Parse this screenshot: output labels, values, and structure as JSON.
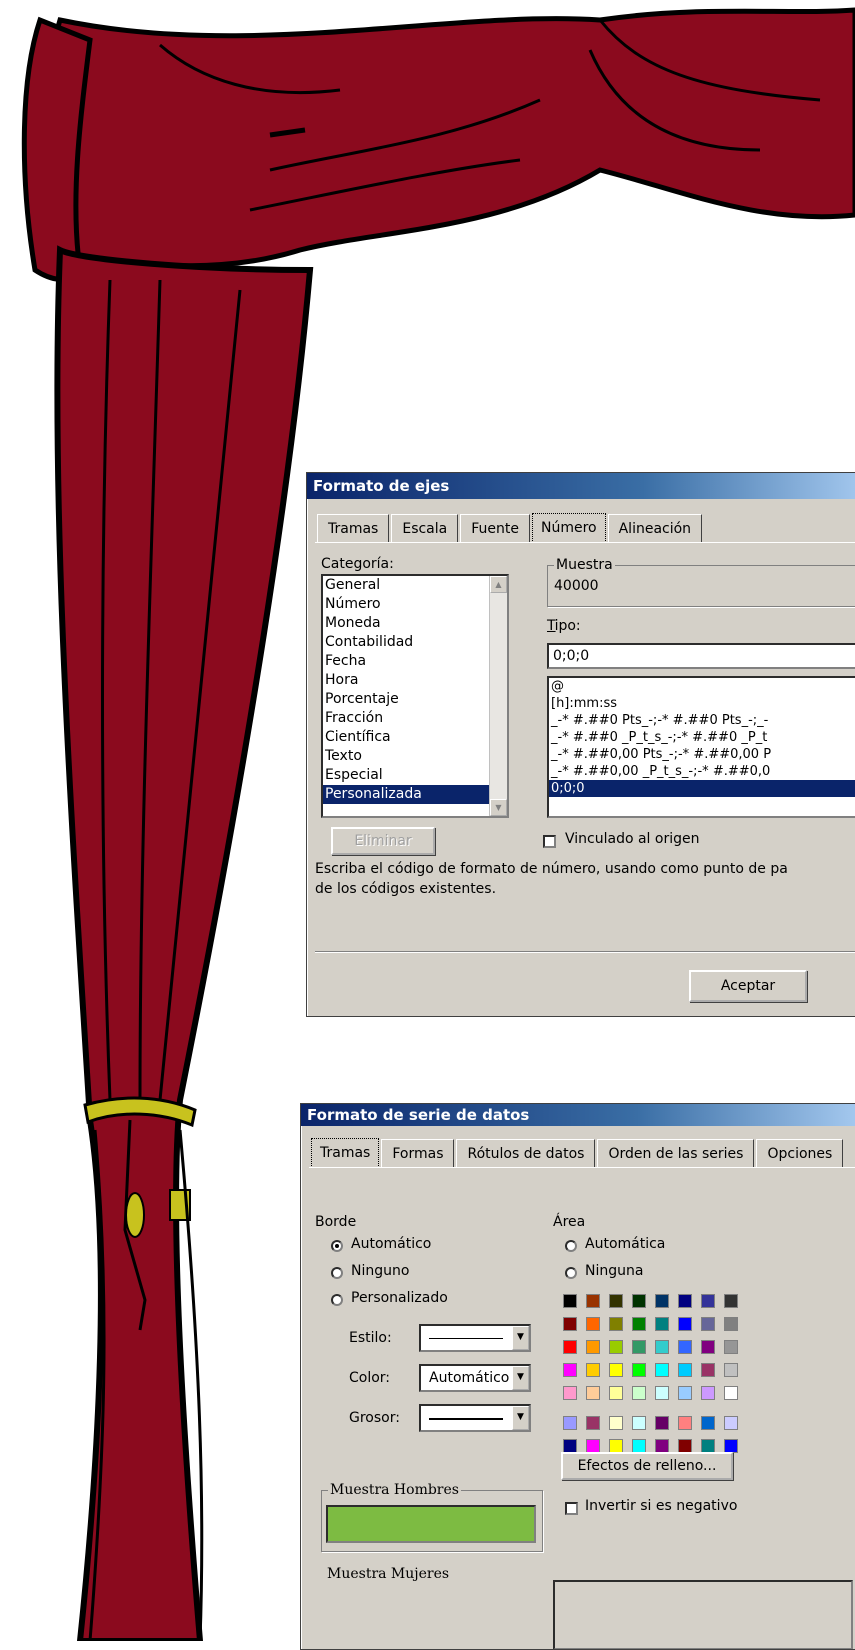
{
  "dialog1": {
    "title": "Formato de ejes",
    "tabs": [
      "Tramas",
      "Escala",
      "Fuente",
      "Número",
      "Alineación"
    ],
    "category_label": "Categoría:",
    "categories": [
      "General",
      "Número",
      "Moneda",
      "Contabilidad",
      "Fecha",
      "Hora",
      "Porcentaje",
      "Fracción",
      "Científica",
      "Texto",
      "Especial",
      "Personalizada"
    ],
    "selected_category": "Personalizada",
    "sample_label": "Muestra",
    "sample_value": "40000",
    "type_label": "Tipo:",
    "type_value": "0;0;0",
    "formats": [
      "@",
      "[h]:mm:ss",
      "_-* #.##0 Pts_-;-* #.##0 Pts_-;_-",
      "_-* #.##0 _P_t_s_-;-* #.##0 _P_t",
      "_-* #.##0,00 Pts_-;-* #.##0,00 P",
      "_-* #.##0,00 _P_t_s_-;-* #.##0,0",
      "0;0;0"
    ],
    "delete_button": "Eliminar",
    "linked_label": "Vinculado al origen",
    "description_line1": "Escriba el código de formato de número, usando como punto de pa",
    "description_line2": "de los códigos existentes.",
    "ok_button": "Aceptar"
  },
  "dialog2": {
    "title": "Formato de serie de datos",
    "tabs": [
      "Tramas",
      "Formas",
      "Rótulos de datos",
      "Orden de las series",
      "Opciones"
    ],
    "border_group": "Borde",
    "border_options": [
      "Automático",
      "Ninguno",
      "Personalizado"
    ],
    "border_selected": "Automático",
    "style_label": "Estilo:",
    "color_label": "Color:",
    "color_value": "Automático",
    "weight_label": "Grosor:",
    "sample_men_label": "Muestra Hombres",
    "sample_men_color": "#7dbb42",
    "sample_women_label": "Muestra Mujeres",
    "area_group": "Área",
    "area_options": [
      "Automática",
      "Ninguna"
    ],
    "fill_effects_button": "Efectos de relleno...",
    "invert_label": "Invertir si es negativo",
    "palette_rows": [
      [
        "#000000",
        "#993300",
        "#333300",
        "#003300",
        "#003366",
        "#000080",
        "#333399",
        "#333333"
      ],
      [
        "#800000",
        "#ff6600",
        "#808000",
        "#008000",
        "#008080",
        "#0000ff",
        "#666699",
        "#808080"
      ],
      [
        "#ff0000",
        "#ff9900",
        "#99cc00",
        "#339966",
        "#33cccc",
        "#3366ff",
        "#800080",
        "#969696"
      ],
      [
        "#ff00ff",
        "#ffcc00",
        "#ffff00",
        "#00ff00",
        "#00ffff",
        "#00ccff",
        "#993366",
        "#c0c0c0"
      ],
      [
        "#ff99cc",
        "#ffcc99",
        "#ffff99",
        "#ccffcc",
        "#ccffff",
        "#99ccff",
        "#cc99ff",
        "#ffffff"
      ]
    ],
    "palette_extra_rows": [
      [
        "#9999ff",
        "#993366",
        "#ffffcc",
        "#ccffff",
        "#660066",
        "#ff8080",
        "#0066cc",
        "#ccccff"
      ],
      [
        "#000080",
        "#ff00ff",
        "#ffff00",
        "#00ffff",
        "#800080",
        "#800000",
        "#008080",
        "#0000ff"
      ]
    ],
    "selected_swatch_color": "#99cc00"
  },
  "colors": {
    "curtain": "#8b0a1e",
    "curtain_dark": "#5e0614",
    "tieback": "#c8c21e"
  }
}
